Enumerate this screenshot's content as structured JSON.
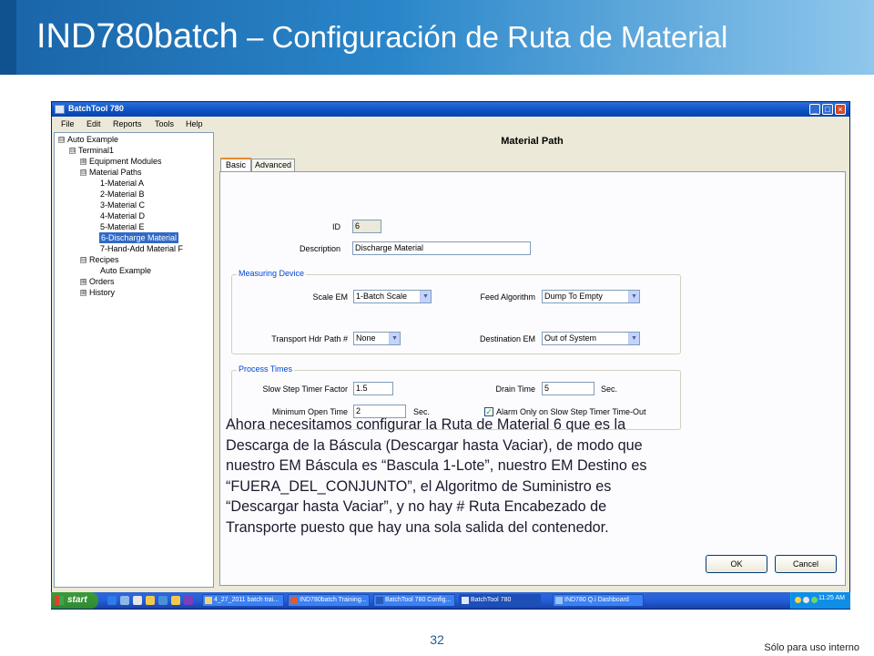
{
  "slide": {
    "title_main": "IND780batch",
    "title_sub": " – Configuración de Ruta de Material",
    "page_number": "32",
    "footer_note": "Sólo para uso interno",
    "note": [
      "Ahora necesitamos configurar la Ruta de Material 6 que es la",
      "Descarga de la Báscula (Descargar hasta Vaciar), de modo que",
      "nuestro EM Báscula es “Bascula 1-Lote”, nuestro EM Destino es",
      "“FUERA_DEL_CONJUNTO”,  el Algoritmo de Suministro es",
      "“Descargar hasta Vaciar”, y no hay # Ruta Encabezado de",
      "Transporte puesto que hay una sola salida del contenedor."
    ]
  },
  "app": {
    "window_title": "BatchTool 780",
    "window_buttons": [
      "_",
      "□",
      "×"
    ],
    "menu": [
      "File",
      "Edit",
      "Reports",
      "Tools",
      "Help"
    ],
    "tree": [
      {
        "label": "Auto Example",
        "toggle": "⊟"
      },
      {
        "label": "Terminal1",
        "toggle": "⊟"
      },
      {
        "label": "Equipment Modules",
        "toggle": "⊞"
      },
      {
        "label": "Material Paths",
        "toggle": "⊟"
      },
      {
        "label": "1-Material A",
        "toggle": ""
      },
      {
        "label": "2-Material B",
        "toggle": ""
      },
      {
        "label": "3-Material C",
        "toggle": ""
      },
      {
        "label": "4-Material D",
        "toggle": ""
      },
      {
        "label": "5-Material E",
        "toggle": ""
      },
      {
        "label": "6-Discharge Material",
        "toggle": "",
        "selected": true
      },
      {
        "label": "7-Hand-Add Material F",
        "toggle": ""
      },
      {
        "label": "Recipes",
        "toggle": "⊟"
      },
      {
        "label": "Auto Example",
        "toggle": ""
      },
      {
        "label": "Orders",
        "toggle": "⊞"
      },
      {
        "label": "History",
        "toggle": "⊞"
      }
    ],
    "panel_title": "Material Path",
    "tabs": [
      "Basic",
      "Advanced"
    ],
    "form": {
      "id_label": "ID",
      "id_value": "6",
      "description_label": "Description",
      "description_value": "Discharge Material",
      "measuring_group": "Measuring Device",
      "scale_em_label": "Scale EM",
      "scale_em_value": "1-Batch Scale",
      "feed_algorithm_label": "Feed Algorithm",
      "feed_algorithm_value": "Dump To Empty",
      "transport_label": "Transport Hdr Path #",
      "transport_value": "None",
      "destination_label": "Destination EM",
      "destination_value": "Out of System",
      "process_group": "Process Times",
      "slow_step_label": "Slow Step Timer Factor",
      "slow_step_value": "1.5",
      "drain_label": "Drain Time",
      "drain_value": "5",
      "drain_unit": "Sec.",
      "min_open_label": "Minimum Open Time",
      "min_open_value": "2",
      "min_open_unit": "Sec.",
      "alarm_label": "Alarm Only on Slow Step Timer Time-Out",
      "alarm_checked": true,
      "check_mark": "✓"
    },
    "ok_label": "OK",
    "cancel_label": "Cancel"
  },
  "taskbar": {
    "start_label": "start",
    "tasks": [
      "4_27_2011 batch trai...",
      "IND780batch Training...",
      "BatchTool 780 Config...",
      "BatchTool 780",
      "IND780 Q.i Dashboard"
    ],
    "clock": "11:25 AM"
  }
}
